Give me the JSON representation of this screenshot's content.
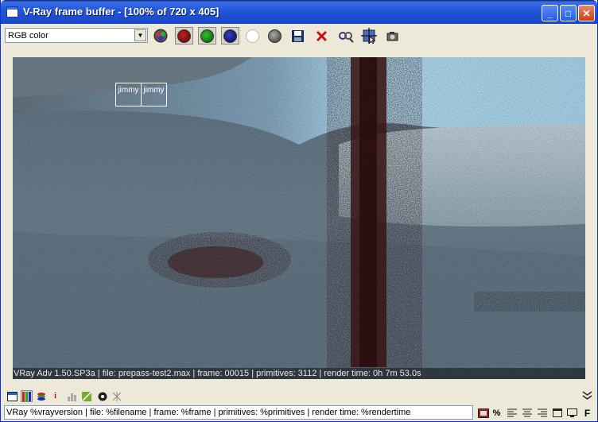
{
  "window": {
    "title": "V-Ray frame buffer - [100% of 720 x 405]",
    "minimize_label": "_",
    "maximize_label": "□",
    "close_label": "✕"
  },
  "toolbar": {
    "channel_select": {
      "value": "RGB color"
    },
    "tools": [
      {
        "name": "rgb-channels-icon",
        "color": "#6a8a6a"
      },
      {
        "name": "red-channel-icon",
        "color": "#8a1010"
      },
      {
        "name": "green-channel-icon",
        "color": "#109010"
      },
      {
        "name": "blue-channel-icon",
        "color": "#101080"
      },
      {
        "name": "alpha-channel-icon",
        "color": "#ffffff"
      },
      {
        "name": "mono-display-icon",
        "color": "#707070"
      },
      {
        "name": "save-image-icon"
      },
      {
        "name": "clear-image-icon"
      },
      {
        "name": "link-to-3dsmax-fb-icon"
      },
      {
        "name": "region-render-icon"
      },
      {
        "name": "render-last-icon"
      }
    ]
  },
  "viewport": {
    "regions": [
      {
        "label": "jimmy"
      },
      {
        "label": "jimmy"
      }
    ],
    "stamp_text": "VRay Adv 1.50.SP3a | file: prepass-test2.max | frame: 00015 | primitives: 3112 | render time: 0h 7m 53.0s"
  },
  "bottom": {
    "stamp_template": "VRay %vrayversion | file: %filename | frame: %frame | primitives: %primitives | render time: %rendertime",
    "percent_label": "%",
    "font_label": "F"
  }
}
